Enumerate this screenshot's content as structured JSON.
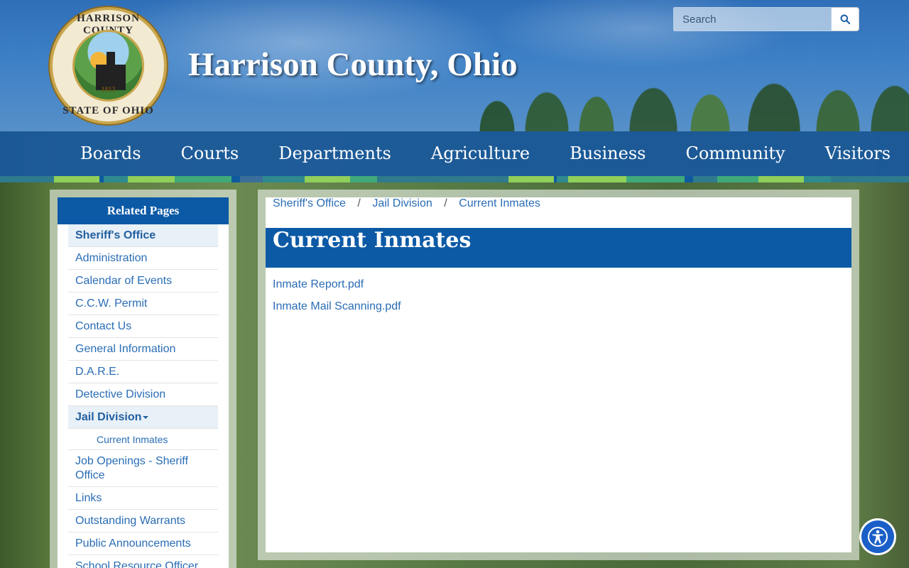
{
  "header": {
    "site_title": "Harrison County, Ohio",
    "seal": {
      "top_text": "HARRISON COUNTY",
      "bottom_text": "STATE OF OHIO",
      "year": "1813"
    }
  },
  "search": {
    "placeholder": "Search",
    "button_icon": "search-icon"
  },
  "nav": {
    "items": [
      "Boards",
      "Courts",
      "Departments",
      "Agriculture",
      "Business",
      "Community",
      "Visitors"
    ]
  },
  "stripe_colors": [
    "#0f5a9e",
    "#8fcf5a",
    "#2e8a8e",
    "#6bb8a8"
  ],
  "sidebar": {
    "heading": "Related Pages",
    "items": [
      "Sheriff's Office",
      "Administration",
      "Calendar of Events",
      "C.C.W. Permit",
      "Contact Us",
      "General Information",
      "D.A.R.E.",
      "Detective Division",
      "Jail Division",
      "Current Inmates",
      "Job Openings - Sheriff Office",
      "Links",
      "Outstanding Warrants",
      "Public Announcements",
      "School Resource Officer"
    ]
  },
  "breadcrumb": {
    "items": [
      "Sheriff's Office",
      "Jail Division",
      "Current Inmates"
    ],
    "separator": "/"
  },
  "main": {
    "title": "Current Inmates",
    "documents": [
      "Inmate Report.pdf",
      "Inmate Mail Scanning.pdf"
    ]
  },
  "accessibility": {
    "icon": "accessibility-icon"
  },
  "colors": {
    "primary": "#0c5aa6",
    "link": "#2a6db5",
    "nav_bg": "#18589e"
  }
}
